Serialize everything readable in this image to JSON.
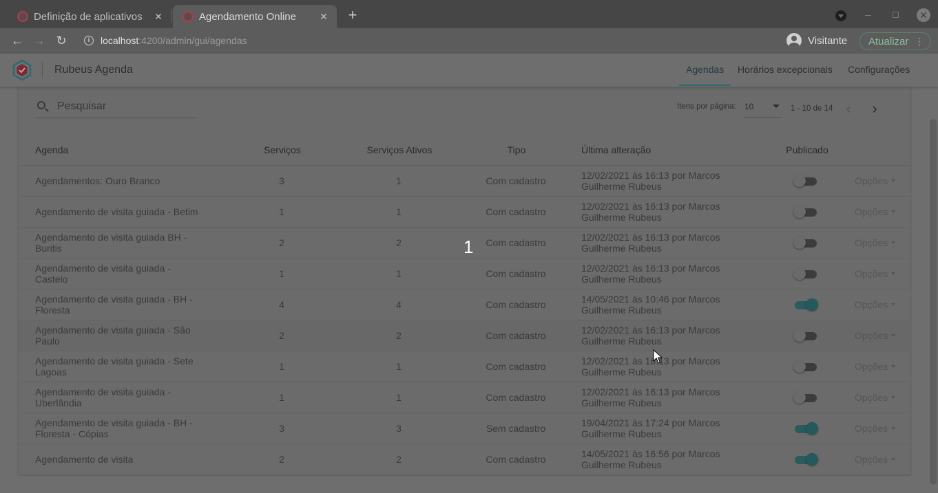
{
  "browser": {
    "tabs": [
      {
        "title": "Definição de aplicativos",
        "active": false
      },
      {
        "title": "Agendamento Online",
        "active": true
      }
    ],
    "new_tab_icon": "plus-icon",
    "url_host": "localhost",
    "url_path": ":4200/admin/gui/agendas",
    "profile_name": "Visitante",
    "update_label": "Atualizar"
  },
  "app": {
    "title": "Rubeus Agenda",
    "tabs": [
      "Agendas",
      "Horários excepcionais",
      "Configurações"
    ],
    "active_tab": "Agendas",
    "accent_color": "#2d6a70"
  },
  "search": {
    "placeholder": "Pesquisar",
    "value": ""
  },
  "pagination": {
    "items_label": "Itens por página:",
    "page_size": "10",
    "range_label": "1 - 10 de 14"
  },
  "table": {
    "columns": [
      "Agenda",
      "Serviços",
      "Serviços Ativos",
      "Tipo",
      "Última alteração",
      "Publicado"
    ],
    "options_label": "Opções",
    "rows": [
      {
        "agenda": "Agendamentos: Ouro Branco",
        "servicos": "3",
        "ativos": "1",
        "tipo": "Com cadastro",
        "alteracao": "12/02/2021 às 16:13 por Marcos Guilherme Rubeus",
        "publicado": false
      },
      {
        "agenda": "Agendamento de visita guiada - Betim",
        "servicos": "1",
        "ativos": "1",
        "tipo": "Com cadastro",
        "alteracao": "12/02/2021 às 16:13 por Marcos Guilherme Rubeus",
        "publicado": false
      },
      {
        "agenda": "Agendamento de visita guiada BH - Buritis",
        "servicos": "2",
        "ativos": "2",
        "tipo": "Com cadastro",
        "alteracao": "12/02/2021 às 16:13 por Marcos Guilherme Rubeus",
        "publicado": false
      },
      {
        "agenda": "Agendamento de visita guiada - Castelo",
        "servicos": "1",
        "ativos": "1",
        "tipo": "Com cadastro",
        "alteracao": "12/02/2021 às 16:13 por Marcos Guilherme Rubeus",
        "publicado": false
      },
      {
        "agenda": "Agendamento de visita guiada - BH - Floresta",
        "servicos": "4",
        "ativos": "4",
        "tipo": "Com cadastro",
        "alteracao": "14/05/2021 às 10:46 por Marcos Guilherme Rubeus",
        "publicado": true
      },
      {
        "agenda": "Agendamento de visita guiada - São Paulo",
        "servicos": "2",
        "ativos": "2",
        "tipo": "Com cadastro",
        "alteracao": "12/02/2021 às 16:13 por Marcos Guilherme Rubeus",
        "publicado": false
      },
      {
        "agenda": "Agendamento de visita guiada - Sete Lagoas",
        "servicos": "1",
        "ativos": "1",
        "tipo": "Com cadastro",
        "alteracao": "12/02/2021 às 16:13 por Marcos Guilherme Rubeus",
        "publicado": false
      },
      {
        "agenda": "Agendamento de visita guiada - Uberlândia",
        "servicos": "1",
        "ativos": "1",
        "tipo": "Com cadastro",
        "alteracao": "12/02/2021 às 16:13 por Marcos Guilherme Rubeus",
        "publicado": false
      },
      {
        "agenda": "Agendamento de visita guiada - BH - Floresta - Cópias",
        "servicos": "3",
        "ativos": "3",
        "tipo": "Sem cadastro",
        "alteracao": "19/04/2021 às 17:24 por Marcos Guilherme Rubeus",
        "publicado": true
      },
      {
        "agenda": "Agendamento de visita",
        "servicos": "2",
        "ativos": "2",
        "tipo": "Com cadastro",
        "alteracao": "14/05/2021 às 16:56 por Marcos Guilherme Rubeus",
        "publicado": true
      }
    ]
  },
  "overlay_number": "1"
}
